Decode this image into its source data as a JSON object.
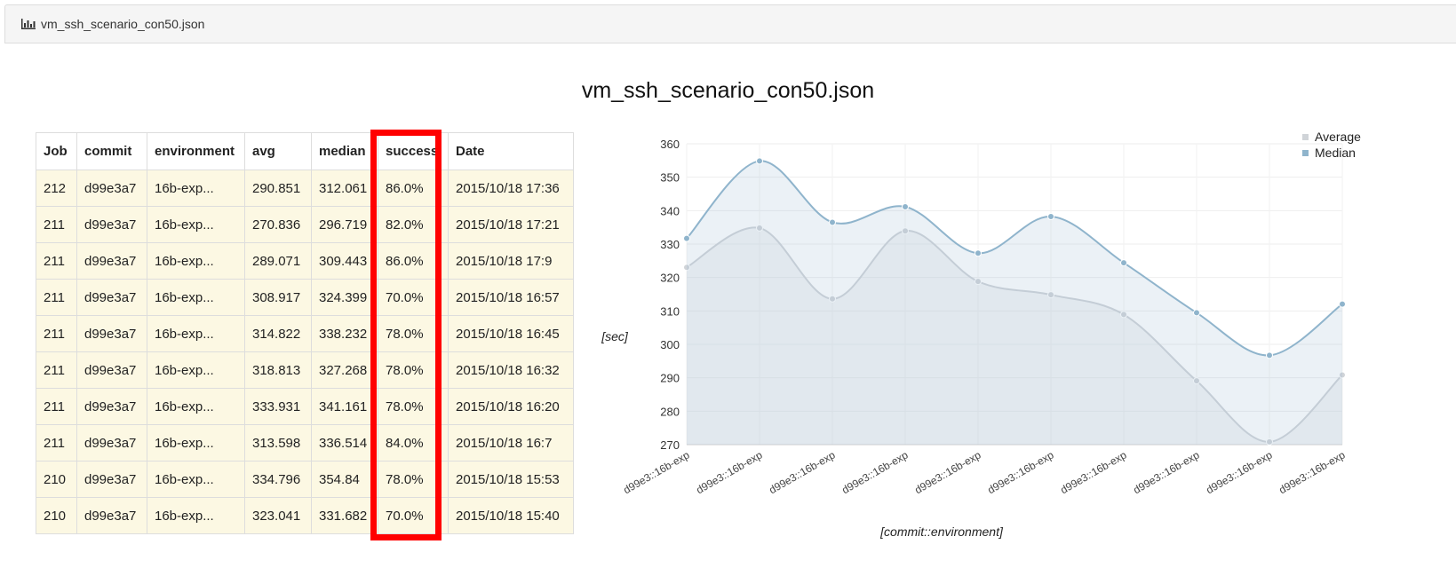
{
  "header": {
    "title": "vm_ssh_scenario_con50.json"
  },
  "page_title": "vm_ssh_scenario_con50.json",
  "table": {
    "columns": [
      "Job",
      "commit",
      "environment",
      "avg",
      "median",
      "success",
      "Date"
    ],
    "rows": [
      [
        "212",
        "d99e3a7",
        "16b-exp...",
        "290.851",
        "312.061",
        "86.0%",
        "2015/10/18 17:36"
      ],
      [
        "211",
        "d99e3a7",
        "16b-exp...",
        "270.836",
        "296.719",
        "82.0%",
        "2015/10/18 17:21"
      ],
      [
        "211",
        "d99e3a7",
        "16b-exp...",
        "289.071",
        "309.443",
        "86.0%",
        "2015/10/18 17:9"
      ],
      [
        "211",
        "d99e3a7",
        "16b-exp...",
        "308.917",
        "324.399",
        "70.0%",
        "2015/10/18 16:57"
      ],
      [
        "211",
        "d99e3a7",
        "16b-exp...",
        "314.822",
        "338.232",
        "78.0%",
        "2015/10/18 16:45"
      ],
      [
        "211",
        "d99e3a7",
        "16b-exp...",
        "318.813",
        "327.268",
        "78.0%",
        "2015/10/18 16:32"
      ],
      [
        "211",
        "d99e3a7",
        "16b-exp...",
        "333.931",
        "341.161",
        "78.0%",
        "2015/10/18 16:20"
      ],
      [
        "211",
        "d99e3a7",
        "16b-exp...",
        "313.598",
        "336.514",
        "84.0%",
        "2015/10/18 16:7"
      ],
      [
        "210",
        "d99e3a7",
        "16b-exp...",
        "334.796",
        "354.84",
        "78.0%",
        "2015/10/18 15:53"
      ],
      [
        "210",
        "d99e3a7",
        "16b-exp...",
        "323.041",
        "331.682",
        "70.0%",
        "2015/10/18 15:40"
      ]
    ]
  },
  "colors": {
    "average": "#d0d4d8",
    "median": "#8fb4cc",
    "highlight": "#ff0000",
    "row_bg": "#fcf8e3"
  },
  "chart_data": {
    "type": "line",
    "title": "",
    "xlabel": "[commit::environment]",
    "ylabel": "[sec]",
    "ylim": [
      270,
      360
    ],
    "yticks": [
      270,
      280,
      290,
      300,
      310,
      320,
      330,
      340,
      350,
      360
    ],
    "categories": [
      "d99e3::16b-exp",
      "d99e3::16b-exp",
      "d99e3::16b-exp",
      "d99e3::16b-exp",
      "d99e3::16b-exp",
      "d99e3::16b-exp",
      "d99e3::16b-exp",
      "d99e3::16b-exp",
      "d99e3::16b-exp",
      "d99e3::16b-exp"
    ],
    "series": [
      {
        "name": "Average",
        "values": [
          323.041,
          334.796,
          313.598,
          333.931,
          318.813,
          314.822,
          308.917,
          289.071,
          270.836,
          290.851
        ]
      },
      {
        "name": "Median",
        "values": [
          331.682,
          354.84,
          336.514,
          341.161,
          327.268,
          338.232,
          324.399,
          309.443,
          296.719,
          312.061
        ]
      }
    ],
    "legend": "top-right",
    "grid": true
  }
}
